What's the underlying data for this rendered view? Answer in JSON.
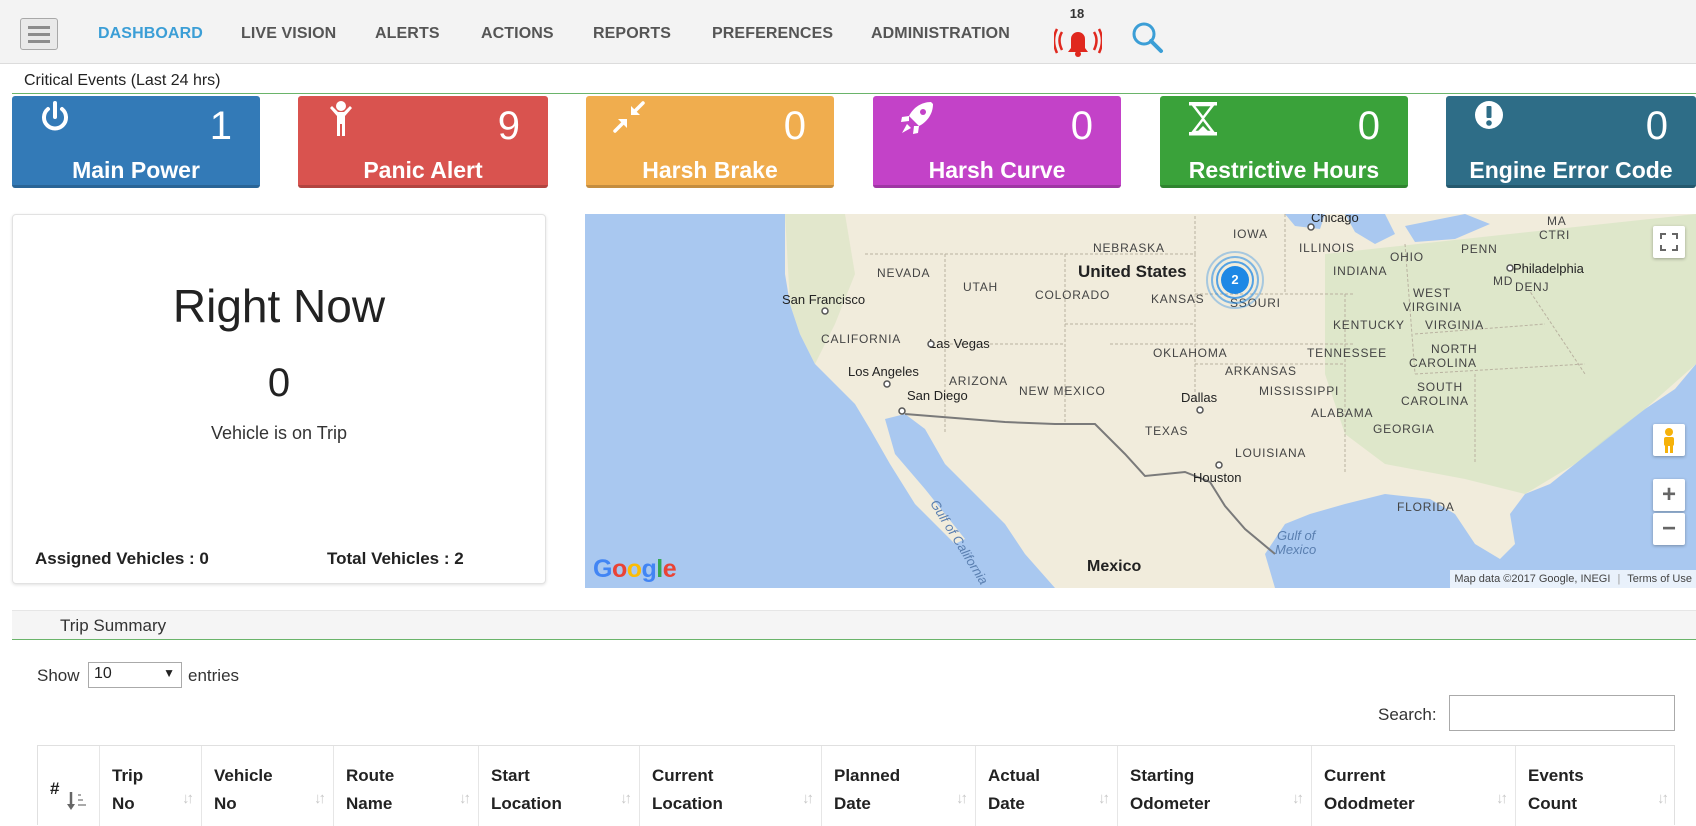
{
  "nav": {
    "items": [
      "DASHBOARD",
      "LIVE VISION",
      "ALERTS",
      "ACTIONS",
      "REPORTS",
      "PREFERENCES",
      "ADMINISTRATION"
    ],
    "active": "DASHBOARD",
    "alarm_count": "18"
  },
  "critical": {
    "title": "Critical Events (Last 24 hrs)",
    "tiles": [
      {
        "label": "Main Power",
        "count": "1",
        "color": "#337ab7",
        "icon": "power-icon"
      },
      {
        "label": "Panic Alert",
        "count": "9",
        "color": "#d9534f",
        "icon": "person-icon"
      },
      {
        "label": "Harsh Brake",
        "count": "0",
        "color": "#f0ad4e",
        "icon": "compress-icon"
      },
      {
        "label": "Harsh Curve",
        "count": "0",
        "color": "#c342c8",
        "icon": "rocket-icon"
      },
      {
        "label": "Restrictive Hours",
        "count": "0",
        "color": "#3aa23a",
        "icon": "hourglass-icon"
      },
      {
        "label": "Engine Error Code",
        "count": "0",
        "color": "#2e6d87",
        "icon": "exclamation-icon"
      }
    ]
  },
  "right_now": {
    "title": "Right Now",
    "count": "0",
    "caption": "Vehicle is on Trip",
    "assigned": "Assigned Vehicles : 0",
    "total": "Total Vehicles : 2"
  },
  "map": {
    "cluster_count": "2",
    "attribution": "Map data ©2017 Google, INEGI",
    "terms": "Terms of Use",
    "logo": "Google",
    "labels": {
      "nebraska": "NEBRASKA",
      "iowa": "IOWA",
      "illinois": "ILLINOIS",
      "ohio": "OHIO",
      "penn": "PENN",
      "ma": "MA",
      "ctri": "CTRI",
      "indiana": "INDIANA",
      "md": "MD",
      "de": "DE",
      "nj": "NJ",
      "nevada": "NEVADA",
      "utah": "UTAH",
      "colorado": "COLORADO",
      "kansas": "KANSAS",
      "missouri": "SSOURI",
      "west_virginia_1": "WEST",
      "west_virginia_2": "VIRGINIA",
      "kentucky": "KENTUCKY",
      "virginia": "VIRGINIA",
      "california": "CALIFORNIA",
      "oklahoma": "OKLAHOMA",
      "tennessee": "TENNESSEE",
      "north_carolina_1": "NORTH",
      "north_carolina_2": "CAROLINA",
      "arkansas": "ARKANSAS",
      "arizona": "ARIZONA",
      "new_mexico": "NEW MEXICO",
      "mississippi": "MISSISSIPPI",
      "south_carolina_1": "SOUTH",
      "south_carolina_2": "CAROLINA",
      "alabama": "ALABAMA",
      "georgia": "GEORGIA",
      "texas": "TEXAS",
      "louisiana": "LOUISIANA",
      "florida": "FLORIDA"
    },
    "cities": {
      "chicago": "Chicago",
      "philadelphia": "Philadelphia",
      "san_francisco": "San Francisco",
      "las_vegas": "Las Vegas",
      "los_angeles": "Los Angeles",
      "san_diego": "San Diego",
      "dallas": "Dallas",
      "houston": "Houston"
    },
    "big": {
      "us": "United States",
      "mexico": "Mexico"
    },
    "water": {
      "gulf_mexico_1": "Gulf of",
      "gulf_mexico_2": "Mexico",
      "gulf_california": "Gulf of California"
    }
  },
  "trip_summary": {
    "title": "Trip Summary",
    "show": "Show",
    "entries_value": "10",
    "entries": "entries",
    "search": "Search:",
    "columns": [
      {
        "l1": "#",
        "l2": ""
      },
      {
        "l1": "Trip",
        "l2": "No"
      },
      {
        "l1": "Vehicle",
        "l2": "No"
      },
      {
        "l1": "Route",
        "l2": "Name"
      },
      {
        "l1": "Start",
        "l2": "Location"
      },
      {
        "l1": "Current",
        "l2": "Location"
      },
      {
        "l1": "Planned",
        "l2": "Date"
      },
      {
        "l1": "Actual",
        "l2": "Date"
      },
      {
        "l1": "Starting",
        "l2": "Odometer"
      },
      {
        "l1": "Current",
        "l2": "Ododmeter"
      },
      {
        "l1": "Events",
        "l2": "Count"
      }
    ]
  }
}
